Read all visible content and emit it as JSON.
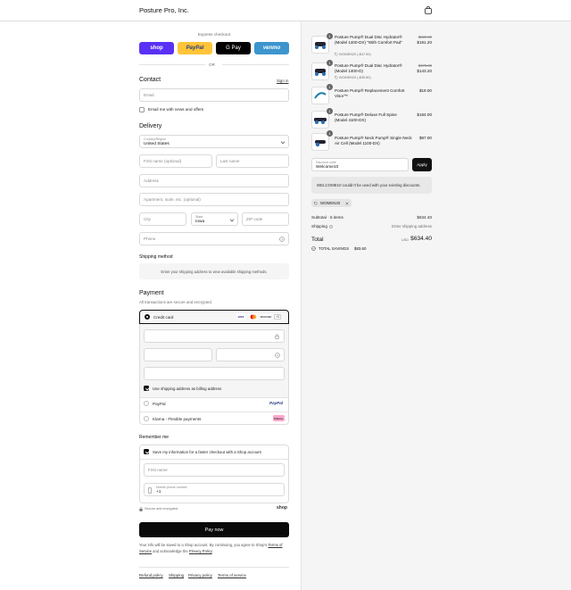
{
  "header": {
    "store_name": "Posture Pro, Inc."
  },
  "express": {
    "label": "Express checkout",
    "or": "OR",
    "buttons": [
      {
        "label": "shop",
        "color": "#5a31f4"
      },
      {
        "label": "PayPal",
        "color": "#ffc439"
      },
      {
        "label": "G Pay",
        "color": "#000000"
      },
      {
        "label": "venmo",
        "color": "#3d95ce"
      }
    ]
  },
  "contact": {
    "title": "Contact",
    "signin": "Sign in",
    "email_placeholder": "Email",
    "news_label": "Email me with news and offers"
  },
  "delivery": {
    "title": "Delivery",
    "country_label": "Country/Region",
    "country_value": "United States",
    "first_name": "First name (optional)",
    "last_name": "Last name",
    "address": "Address",
    "apartment": "Apartment, suite, etc. (optional)",
    "city": "City",
    "state_label": "State",
    "state_value": "Iowa",
    "zip": "ZIP code",
    "phone": "Phone"
  },
  "shipping": {
    "title": "Shipping method",
    "note": "Enter your shipping address to view available shipping methods."
  },
  "payment": {
    "title": "Payment",
    "subtitle": "All transactions are secure and encrypted.",
    "credit_card": "Credit card",
    "card_logos": [
      "VISA",
      "MC",
      "DISCOVER"
    ],
    "more_cards": "+3",
    "billing_label": "Use shipping address as billing address",
    "paypal": "PayPal",
    "paypal_logo": "PayPal",
    "klarna": "Klarna - Flexible payments",
    "klarna_logo": "Klarna."
  },
  "remember": {
    "title": "Remember me",
    "save_label": "Save my information for a faster checkout with a Shop account",
    "first_name": "First name",
    "mobile_label": "Mobile phone number",
    "mobile_prefix": "+1",
    "secure": "Secure and encrypted",
    "shop_logo": "shop"
  },
  "pay_now": "Pay now",
  "legal": {
    "text1": "Your info will be saved to a Shop account. By continuing, you agree to Shop's",
    "tos": "Terms of Service",
    "text2": "and acknowledge the",
    "privacy": "Privacy Policy",
    "end": "."
  },
  "footer": {
    "links": [
      "Refund policy",
      "Shipping",
      "Privacy policy",
      "Terms of service"
    ]
  },
  "cart": {
    "items": [
      {
        "qty": "1",
        "name": "Posture Pump® Dual Disc Hydrator® (Model 1400-DX) \"With Comfort Pad\"",
        "discount": "WOMEN20 (-$47.90)",
        "old_price": "$239.00",
        "price": "$191.20"
      },
      {
        "qty": "1",
        "name": "Posture Pump® Dual Disc Hydrator® (Model 1400-D)",
        "discount": "WOMEN20 (-$35.80)",
        "old_price": "$179.00",
        "price": "$143.20"
      },
      {
        "qty": "1",
        "name": "Posture Pump® Replacement Comfort Visor™",
        "discount": "",
        "old_price": "",
        "price": "$19.00"
      },
      {
        "qty": "1",
        "name": "Posture Pump® Deluxe Full Spine (Model 4100-DX)",
        "discount": "",
        "old_price": "",
        "price": "$184.00"
      },
      {
        "qty": "1",
        "name": "Posture Pump® Neck Pump® Single Neck Air Cell (Model 1100-DX)",
        "discount": "",
        "old_price": "",
        "price": "$97.00"
      }
    ],
    "discount_label": "Discount code",
    "discount_value": "Welcome10",
    "apply": "Apply",
    "error": "WELCOME10 couldn't be used with your existing discounts.",
    "tag": "WOMEN20",
    "subtotal_label": "Subtotal · 5 items",
    "subtotal": "$634.40",
    "shipping_label": "Shipping",
    "shipping_value": "Enter shipping address",
    "total_label": "Total",
    "currency": "USD",
    "total": "$634.40",
    "savings_label": "TOTAL SAVINGS",
    "savings": "$83.60"
  }
}
